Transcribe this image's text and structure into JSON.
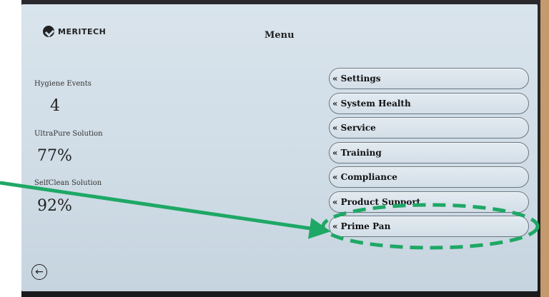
{
  "header": {
    "logo_text": "MERITECH",
    "title": "Menu"
  },
  "stats": [
    {
      "label": "Hygiene Events",
      "value": "4"
    },
    {
      "label": "UltraPure Solution",
      "value": "77%"
    },
    {
      "label": "SelfClean Solution",
      "value": "92%"
    }
  ],
  "menu": [
    {
      "label": "« Settings"
    },
    {
      "label": "« System Health"
    },
    {
      "label": "« Service"
    },
    {
      "label": "« Training"
    },
    {
      "label": "« Compliance"
    },
    {
      "label": "« Product Support"
    },
    {
      "label": "« Prime Pan"
    }
  ],
  "footer": {
    "back_icon": "back-arrow-icon"
  },
  "annotation": {
    "arrow_color": "#1ea865",
    "highlight_target": "« Prime Pan"
  },
  "colors": {
    "annotation": "#1ea865",
    "screen": "#d0dce6"
  }
}
